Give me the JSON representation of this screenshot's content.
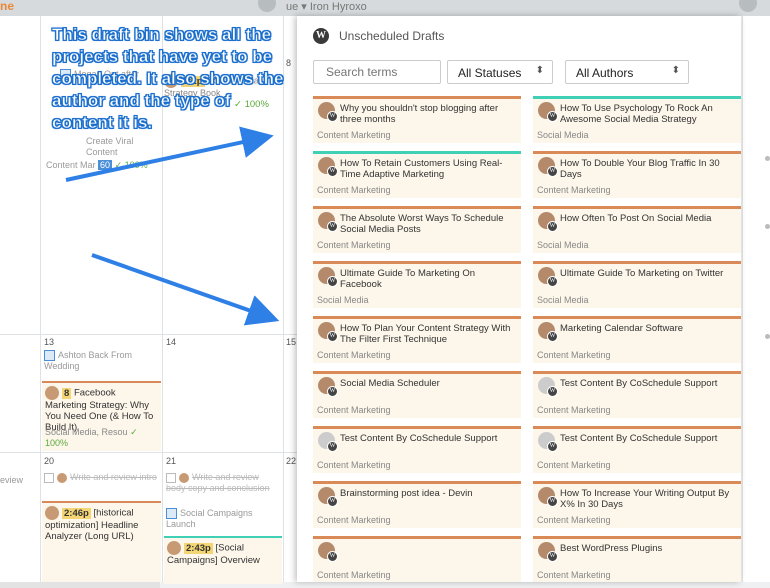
{
  "topbar": {
    "brand_fragment": "ne",
    "nav_fragment": "ue ▾ Iron Hyroxo"
  },
  "annotation": {
    "text": "This draft bin shows all the projects that have yet to be completed.  It also shows the author and the type of content it is."
  },
  "calendar": {
    "days": {
      "d8": "8",
      "d13": "13",
      "d14": "14",
      "d15": "15",
      "d20": "20",
      "d21": "21",
      "d22": "22"
    },
    "items": {
      "megan": "Megan Out after",
      "social_book_time": "2:2p",
      "social_book_title": "Social Media Strategy Book",
      "social_book_pct": "✓ 100%",
      "create_partial": "Create Viral Content",
      "content_mkt_meta": "Content Mar",
      "content_mkt_count": "60",
      "content_mkt_pct": "✓ 100%",
      "ashton": "Ashton Back From Wedding",
      "fb_count": "8",
      "fb_title": "Facebook Marketing Strategy: Why You Need One (& How To Build It)",
      "fb_meta": "Social Media, Resou",
      "fb_pct": "✓ 100%",
      "review_frag": "eview",
      "write_review": "Write and review intro",
      "write_review_body": "Write and review body copy and conclusion",
      "hist_time": "2:46p",
      "hist_title": "[historical optimization] Headline Analyzer (Long URL)",
      "social_campaigns": "Social Campaigns Launch",
      "sc_time": "2:43p",
      "sc_title": "[Social Campaigns] Overview"
    }
  },
  "drafts_panel": {
    "title": "Unscheduled Drafts",
    "wp_glyph": "W",
    "search_placeholder": "Search terms",
    "status_filter": "All Statuses",
    "author_filter": "All Authors",
    "dropdown_glyph": "⬍",
    "drafts": [
      {
        "title": "Why you shouldn't stop blogging after three months",
        "category": "Content Marketing",
        "accent": "#d98a56",
        "avatar": "photo"
      },
      {
        "title": "How To Use Psychology To Rock An Awesome Social Media Strategy",
        "category": "Social Media",
        "accent": "#3fd0b5",
        "avatar": "photo"
      },
      {
        "title": "How To Retain Customers Using Real-Time Adaptive Marketing",
        "category": "Content Marketing",
        "accent": "#3fd0b5",
        "avatar": "photo"
      },
      {
        "title": "How To Double Your Blog Traffic In 30 Days",
        "category": "Content Marketing",
        "accent": "#d98a56",
        "avatar": "photo"
      },
      {
        "title": "The Absolute Worst Ways To Schedule Social Media Posts",
        "category": "Content Marketing",
        "accent": "#d98a56",
        "avatar": "photo"
      },
      {
        "title": "How Often To Post On Social Media",
        "category": "Social Media",
        "accent": "#d98a56",
        "avatar": "photo"
      },
      {
        "title": "Ultimate Guide To Marketing On Facebook",
        "category": "Social Media",
        "accent": "#d98a56",
        "avatar": "photo"
      },
      {
        "title": "Ultimate Guide To Marketing on Twitter",
        "category": "Social Media",
        "accent": "#d98a56",
        "avatar": "photo"
      },
      {
        "title": "How To Plan Your Content Strategy With The Filter First Technique",
        "category": "Content Marketing",
        "accent": "#d98a56",
        "avatar": "photo"
      },
      {
        "title": "Marketing Calendar Software",
        "category": "Content Marketing",
        "accent": "#d98a56",
        "avatar": "photo"
      },
      {
        "title": "Social Media Scheduler",
        "category": "Content Marketing",
        "accent": "#d98a56",
        "avatar": "photo"
      },
      {
        "title": "Test Content By CoSchedule Support",
        "category": "Content Marketing",
        "accent": "#d98a56",
        "avatar": "grey"
      },
      {
        "title": "Test Content By CoSchedule Support",
        "category": "Content Marketing",
        "accent": "#d98a56",
        "avatar": "grey"
      },
      {
        "title": "Test Content By CoSchedule Support",
        "category": "Content Marketing",
        "accent": "#d98a56",
        "avatar": "grey"
      },
      {
        "title": "Brainstorming post idea - Devin",
        "category": "Content Marketing",
        "accent": "#d98a56",
        "avatar": "photo"
      },
      {
        "title": "How To Increase Your Writing Output By X% In 30 Days",
        "category": "Content Marketing",
        "accent": "#d98a56",
        "avatar": "photo"
      },
      {
        "title": "",
        "category": "Content Marketing",
        "accent": "#d98a56",
        "avatar": "photo"
      },
      {
        "title": "Best WordPress Plugins",
        "category": "Content Marketing",
        "accent": "#d98a56",
        "avatar": "photo"
      }
    ]
  }
}
